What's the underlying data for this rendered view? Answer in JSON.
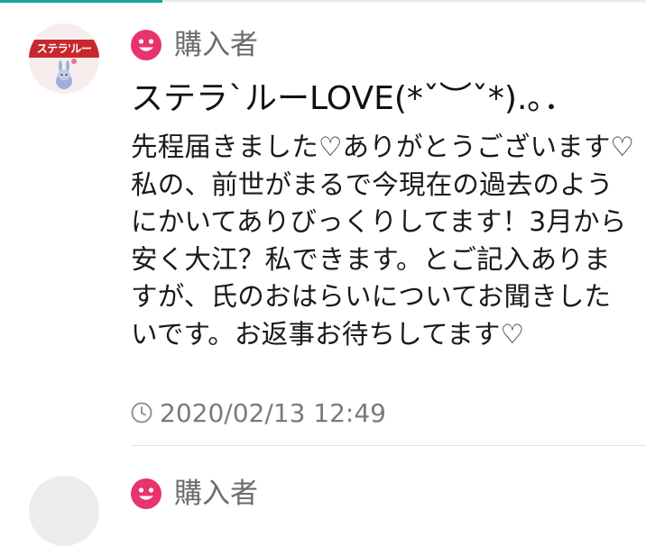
{
  "accent_color": "#1aa39a",
  "reviews": [
    {
      "role_icon": "smile-icon",
      "role_label": "購入者",
      "avatar_text": "ステラ'ルー",
      "title": "ステラ`ルーLOVE(*ˇ︶ˇ*).｡．",
      "body": "先程届きました♡ありがとうございます♡私の、前世がまるで今現在の過去のようにかいてありびっくりしてます！3月から安く大江？私できます。とご記入ありますが、氏のおはらいについてお聞きしたいです。お返事お待ちしてます♡",
      "date_icon": "clock-icon",
      "date": "2020/02/13 12:49",
      "role_color": "#e8336d"
    },
    {
      "role_icon": "smile-icon",
      "role_label": "購入者"
    }
  ]
}
